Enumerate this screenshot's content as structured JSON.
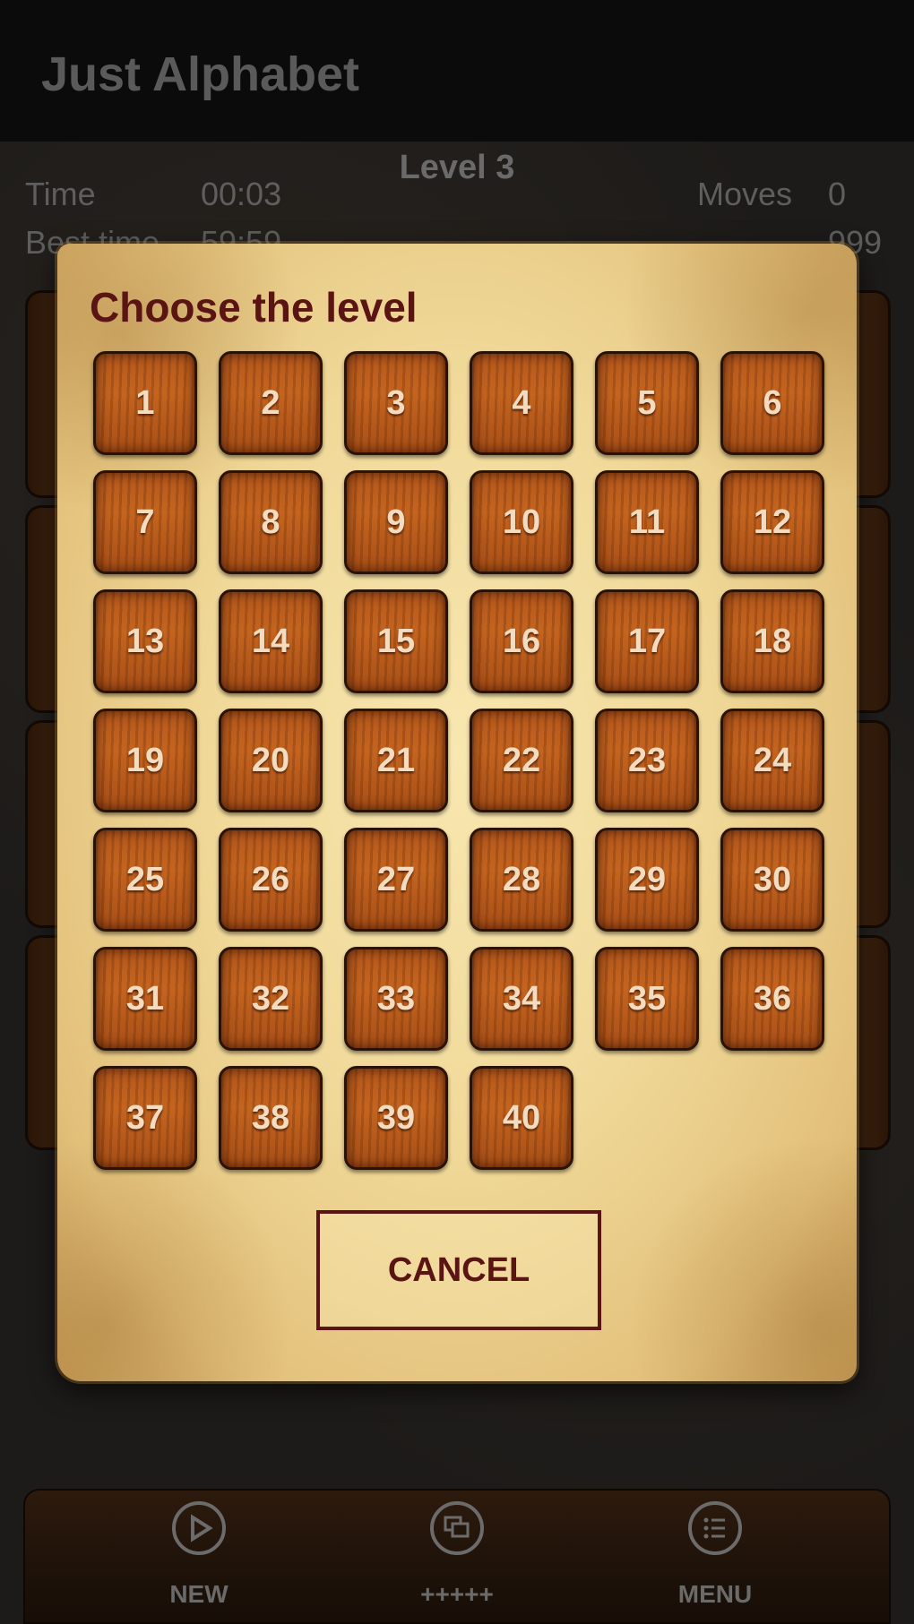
{
  "app": {
    "title": "Just Alphabet"
  },
  "game": {
    "level": "Level 3",
    "time_label": "Time",
    "time_value": "00:03",
    "best_time_label": "Best time",
    "best_time_value": "59:59",
    "moves_label": "Moves",
    "moves_value": "0",
    "best_moves_value": "999"
  },
  "dialog": {
    "title": "Choose the level",
    "levels": [
      "1",
      "2",
      "3",
      "4",
      "5",
      "6",
      "7",
      "8",
      "9",
      "10",
      "11",
      "12",
      "13",
      "14",
      "15",
      "16",
      "17",
      "18",
      "19",
      "20",
      "21",
      "22",
      "23",
      "24",
      "25",
      "26",
      "27",
      "28",
      "29",
      "30",
      "31",
      "32",
      "33",
      "34",
      "35",
      "36",
      "37",
      "38",
      "39",
      "40"
    ],
    "cancel_label": "CANCEL"
  },
  "bottom_nav": {
    "new_label": "NEW",
    "new_icon": "play-icon",
    "plus_label": "+++++",
    "plus_icon": "windows-icon",
    "menu_label": "MENU",
    "menu_icon": "list-icon"
  }
}
